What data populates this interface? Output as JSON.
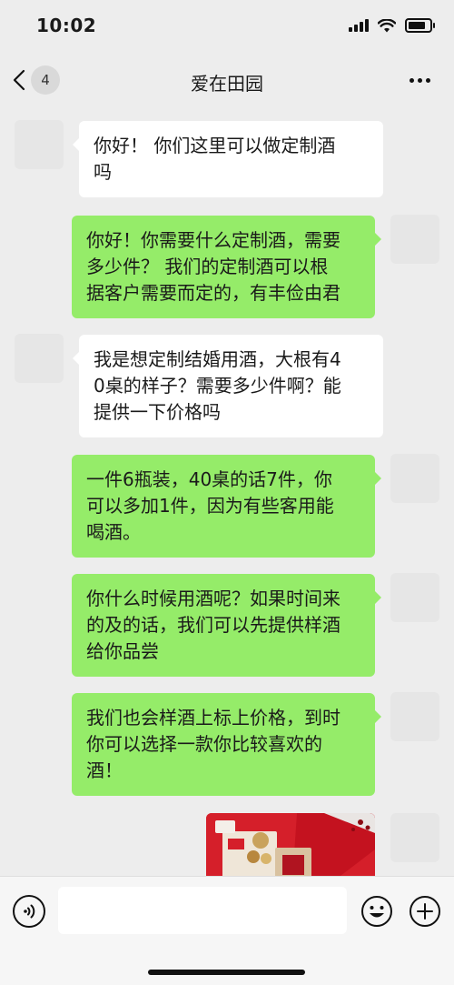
{
  "status_bar": {
    "time": "10:02",
    "icons": [
      "signal-icon",
      "wifi-icon",
      "battery-icon"
    ]
  },
  "nav": {
    "back_icon": "chevron-left-icon",
    "unread_count": "4",
    "title": "爱在田园",
    "more_icon": "more-dots-icon"
  },
  "messages": [
    {
      "direction": "in",
      "lines": [
        "你好！ 你们这里可以做定制酒",
        "吗"
      ]
    },
    {
      "direction": "out",
      "lines": [
        "你好！你需要什么定制酒，需要",
        "多少件？ 我们的定制酒可以根",
        "据客户需要而定的，有丰俭由君"
      ]
    },
    {
      "direction": "in",
      "lines": [
        "我是想定制结婚用酒，大根有4",
        "0桌的样子？需要多少件啊？能",
        "提供一下价格吗"
      ]
    },
    {
      "direction": "out",
      "lines": [
        "一件6瓶装，40桌的话7件，你",
        "可以多加1件，因为有些客用能",
        "喝酒。"
      ]
    },
    {
      "direction": "out",
      "lines": [
        "你什么时候用酒呢？如果时间来",
        "的及的话，我们可以先提供样酒",
        "给你品尝"
      ]
    },
    {
      "direction": "out",
      "lines": [
        "我们也会样酒上标上价格，到时",
        "你可以选择一款你比较喜欢的",
        "酒！"
      ]
    },
    {
      "direction": "out",
      "type": "image",
      "description_icon": "photo-message-icon"
    }
  ],
  "input_bar": {
    "voice_icon": "voice-icon",
    "placeholder": "",
    "emoji_icon": "emoji-icon",
    "plus_icon": "plus-circle-icon"
  },
  "colors": {
    "background": "#ededed",
    "bubble_in": "#ffffff",
    "bubble_out": "#95ec69",
    "input_bar": "#f6f6f6"
  }
}
